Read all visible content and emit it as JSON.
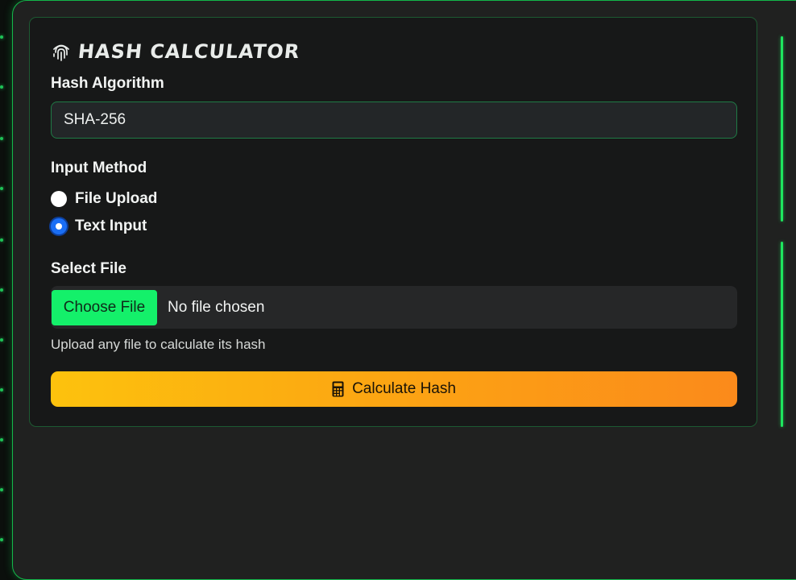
{
  "header": {
    "title": "HASH CALCULATOR",
    "icon": "fingerprint-icon"
  },
  "algorithm": {
    "label": "Hash Algorithm",
    "selected": "SHA-256"
  },
  "input_method": {
    "label": "Input Method",
    "options": [
      {
        "label": "File Upload",
        "checked": false
      },
      {
        "label": "Text Input",
        "checked": true
      }
    ]
  },
  "file": {
    "label": "Select File",
    "choose_label": "Choose File",
    "status": "No file chosen",
    "hint": "Upload any file to calculate its hash"
  },
  "action": {
    "label": "Calculate Hash",
    "icon": "calculator-icon"
  },
  "colors": {
    "accent_green": "#14f06a",
    "border_green": "#1f7a45",
    "button_gradient_start": "#fdc20d",
    "button_gradient_end": "#fb8a1b",
    "radio_checked": "#1a6ef5"
  }
}
